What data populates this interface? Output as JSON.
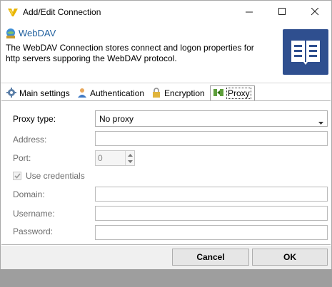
{
  "window": {
    "title": "Add/Edit Connection"
  },
  "header": {
    "title": "WebDAV",
    "description": "The WebDAV Connection stores connect and logon properties for http servers supporing the WebDAV protocol."
  },
  "tabs": [
    {
      "label": "Main settings",
      "icon": "gear-icon"
    },
    {
      "label": "Authentication",
      "icon": "user-icon"
    },
    {
      "label": "Encryption",
      "icon": "lock-icon"
    },
    {
      "label": "Proxy",
      "icon": "proxy-icon",
      "active": true
    }
  ],
  "proxy": {
    "type_label": "Proxy type:",
    "type_value": "No proxy",
    "address_label": "Address:",
    "address_value": "",
    "port_label": "Port:",
    "port_value": "0",
    "use_credentials_label": "Use credentials",
    "use_credentials_checked": true,
    "domain_label": "Domain:",
    "domain_value": "",
    "username_label": "Username:",
    "username_value": "",
    "password_label": "Password:",
    "password_value": ""
  },
  "buttons": {
    "cancel": "Cancel",
    "ok": "OK"
  },
  "colors": {
    "header_title": "#1f5f9e",
    "badge": "#2f4f8f",
    "disabled_text": "#6d6d6d"
  }
}
